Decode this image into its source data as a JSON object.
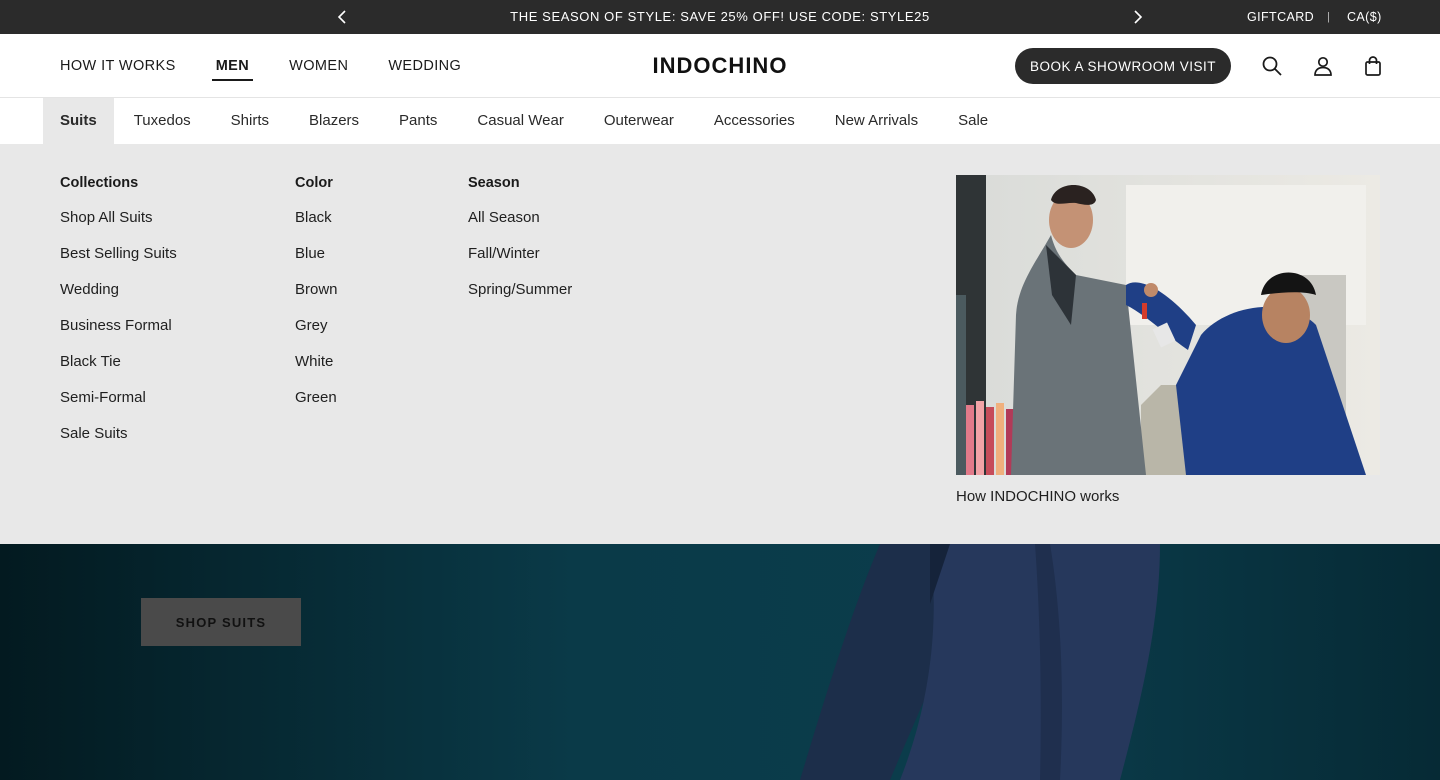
{
  "promo": {
    "text": "THE SEASON OF STYLE: SAVE 25% OFF! USE CODE: STYLE25",
    "giftcard": "GIFTCARD",
    "separator": "|",
    "currency": "CA($)"
  },
  "header": {
    "nav": [
      "HOW IT WORKS",
      "MEN",
      "WOMEN",
      "WEDDING"
    ],
    "active_nav": "MEN",
    "logo": "INDOCHINO",
    "book_button": "BOOK A SHOWROOM VISIT"
  },
  "categories": [
    "Suits",
    "Tuxedos",
    "Shirts",
    "Blazers",
    "Pants",
    "Casual Wear",
    "Outerwear",
    "Accessories",
    "New Arrivals",
    "Sale"
  ],
  "active_category": "Suits",
  "mega_menu": {
    "collections": {
      "heading": "Collections",
      "items": [
        "Shop All Suits",
        "Best Selling Suits",
        "Wedding",
        "Business Formal",
        "Black Tie",
        "Semi-Formal",
        "Sale Suits"
      ]
    },
    "color": {
      "heading": "Color",
      "items": [
        "Black",
        "Blue",
        "Brown",
        "Grey",
        "White",
        "Green"
      ]
    },
    "season": {
      "heading": "Season",
      "items": [
        "All Season",
        "Fall/Winter",
        "Spring/Summer"
      ]
    },
    "feature_caption": "How INDOCHINO works"
  },
  "hero": {
    "shop_button": "SHOP SUITS"
  },
  "colors": {
    "promo_bg": "#2b2b2b",
    "menu_bg": "#e8e8e8",
    "hero_bg": "#0b3d4c"
  }
}
